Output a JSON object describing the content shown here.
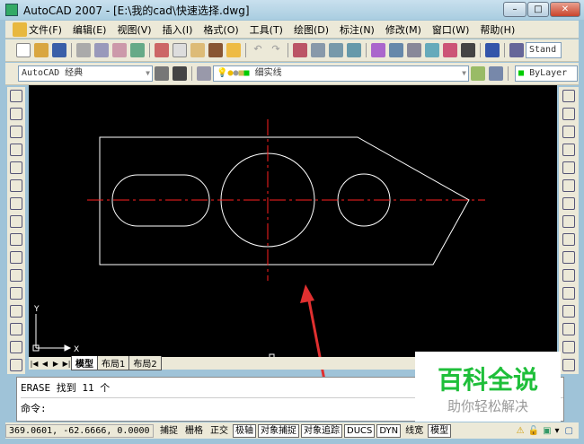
{
  "window": {
    "title": "AutoCAD 2007 - [E:\\我的cad\\快速选择.dwg]",
    "min": "–",
    "max": "□",
    "close": "✕"
  },
  "menu": [
    "文件(F)",
    "编辑(E)",
    "视图(V)",
    "插入(I)",
    "格式(O)",
    "工具(T)",
    "绘图(D)",
    "标注(N)",
    "修改(M)",
    "窗口(W)",
    "帮助(H)"
  ],
  "toolbar": {
    "text_style": "Stand",
    "workspace": "AutoCAD 经典",
    "layer": "细实线",
    "color": "ByLayer"
  },
  "tabs": [
    "模型",
    "布局1",
    "布局2"
  ],
  "ucs": {
    "x": "X",
    "y": "Y"
  },
  "command": {
    "line1": "ERASE 找到 11 个",
    "line2": "命令:"
  },
  "status": {
    "coords": "369.0601, -62.6666, 0.0000",
    "buttons": [
      {
        "label": "捕捉",
        "on": false
      },
      {
        "label": "栅格",
        "on": false
      },
      {
        "label": "正交",
        "on": false
      },
      {
        "label": "极轴",
        "on": true
      },
      {
        "label": "对象捕捉",
        "on": true
      },
      {
        "label": "对象追踪",
        "on": true
      },
      {
        "label": "DUCS",
        "on": true
      },
      {
        "label": "DYN",
        "on": true
      },
      {
        "label": "线宽",
        "on": false
      },
      {
        "label": "模型",
        "on": true
      }
    ]
  },
  "watermark": {
    "title": "百科全说",
    "subtitle": "助你轻松解决"
  },
  "colors": {
    "canvas": "#000000",
    "centerline": "#ff2020",
    "geometry": "#ffffff",
    "arrow": "#e03030",
    "brand": "#1fbf3a"
  }
}
